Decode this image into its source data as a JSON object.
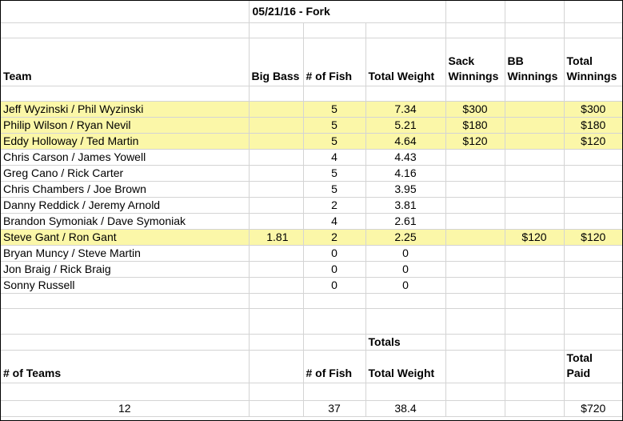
{
  "title": "05/21/16 - Fork",
  "headers": {
    "team": "Team",
    "big_bass": "Big Bass",
    "num_fish": "# of Fish",
    "total_weight": "Total Weight",
    "sack_line1": "Sack",
    "sack_line2": "Winnings",
    "bb_line1": "BB",
    "bb_line2": "Winnings",
    "total_line1": "Total",
    "total_line2": "Winnings"
  },
  "rows": [
    {
      "team": "Jeff Wyzinski / Phil Wyzinski",
      "big_bass": "",
      "fish": "5",
      "weight": "7.34",
      "sack": "$300",
      "bb": "",
      "total": "$300",
      "highlight": true
    },
    {
      "team": "Philip Wilson / Ryan Nevil",
      "big_bass": "",
      "fish": "5",
      "weight": "5.21",
      "sack": "$180",
      "bb": "",
      "total": "$180",
      "highlight": true
    },
    {
      "team": "Eddy Holloway / Ted Martin",
      "big_bass": "",
      "fish": "5",
      "weight": "4.64",
      "sack": "$120",
      "bb": "",
      "total": "$120",
      "highlight": true
    },
    {
      "team": "Chris Carson / James Yowell",
      "big_bass": "",
      "fish": "4",
      "weight": "4.43",
      "sack": "",
      "bb": "",
      "total": "",
      "highlight": false
    },
    {
      "team": "Greg Cano / Rick Carter",
      "big_bass": "",
      "fish": "5",
      "weight": "4.16",
      "sack": "",
      "bb": "",
      "total": "",
      "highlight": false
    },
    {
      "team": "Chris Chambers / Joe Brown",
      "big_bass": "",
      "fish": "5",
      "weight": "3.95",
      "sack": "",
      "bb": "",
      "total": "",
      "highlight": false
    },
    {
      "team": "Danny Reddick / Jeremy Arnold",
      "big_bass": "",
      "fish": "2",
      "weight": "3.81",
      "sack": "",
      "bb": "",
      "total": "",
      "highlight": false
    },
    {
      "team": "Brandon Symoniak / Dave Symoniak",
      "big_bass": "",
      "fish": "4",
      "weight": "2.61",
      "sack": "",
      "bb": "",
      "total": "",
      "highlight": false
    },
    {
      "team": "Steve Gant / Ron Gant",
      "big_bass": "1.81",
      "fish": "2",
      "weight": "2.25",
      "sack": "",
      "bb": "$120",
      "total": "$120",
      "highlight": true
    },
    {
      "team": "Bryan Muncy / Steve Martin",
      "big_bass": "",
      "fish": "0",
      "weight": "0",
      "sack": "",
      "bb": "",
      "total": "",
      "highlight": false
    },
    {
      "team": "Jon Braig / Rick Braig",
      "big_bass": "",
      "fish": "0",
      "weight": "0",
      "sack": "",
      "bb": "",
      "total": "",
      "highlight": false
    },
    {
      "team": "Sonny Russell",
      "big_bass": "",
      "fish": "0",
      "weight": "0",
      "sack": "",
      "bb": "",
      "total": "",
      "highlight": false
    }
  ],
  "totals": {
    "label": "Totals",
    "num_teams_label": "# of Teams",
    "num_fish_label": "# of Fish",
    "total_weight_label": "Total Weight",
    "total_paid_line1": "Total",
    "total_paid_line2": "Paid",
    "num_teams": "12",
    "num_fish": "37",
    "total_weight": "38.4",
    "total_paid": "$720"
  },
  "colors": {
    "highlight": "#fbf7a8",
    "gridline": "#d4d4d4"
  }
}
